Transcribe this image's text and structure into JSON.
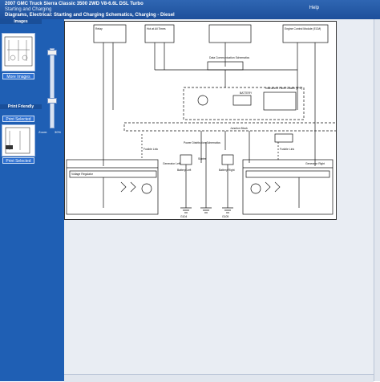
{
  "header": {
    "title": "2007 GMC Truck Sierra Classic 3500 2WD V8-6.6L DSL Turbo",
    "subtitle": "Starting and Charging",
    "breadcrumb": "Diagrams, Electrical: Starting and Charging Schematics, Charging - Diesel",
    "help": "Help"
  },
  "left_panel": {
    "images_label": "Images",
    "more_images": "More Images",
    "print_friendly": "Print Friendly",
    "print_selected_1": "Print Selected",
    "print_selected_2": "Print Selected",
    "zoom_label": "Zoom:",
    "zoom_value": "30%"
  },
  "diagram": {
    "labels": {
      "fuse_hot": "Hot at All Times",
      "relay": "Relay",
      "ecm": "Engine Control Module (ECM)",
      "battery": "BATTERY",
      "ipc": "Instrument Panel Cluster (IPC)",
      "distribution": "Power Distribution Schematics",
      "gen_left": "Generator Left",
      "gen_right": "Generator Right",
      "regulator": "Voltage Regulator",
      "starter": "Starter",
      "battery_left": "Battery Left",
      "battery_right": "Battery Right",
      "data_comm": "Data Communication Schematics",
      "fusible_a": "Fusible Link",
      "fusible_b": "Fusible Link",
      "junction": "Junction Block",
      "ground_l": "G104",
      "ground_r": "G105"
    }
  }
}
